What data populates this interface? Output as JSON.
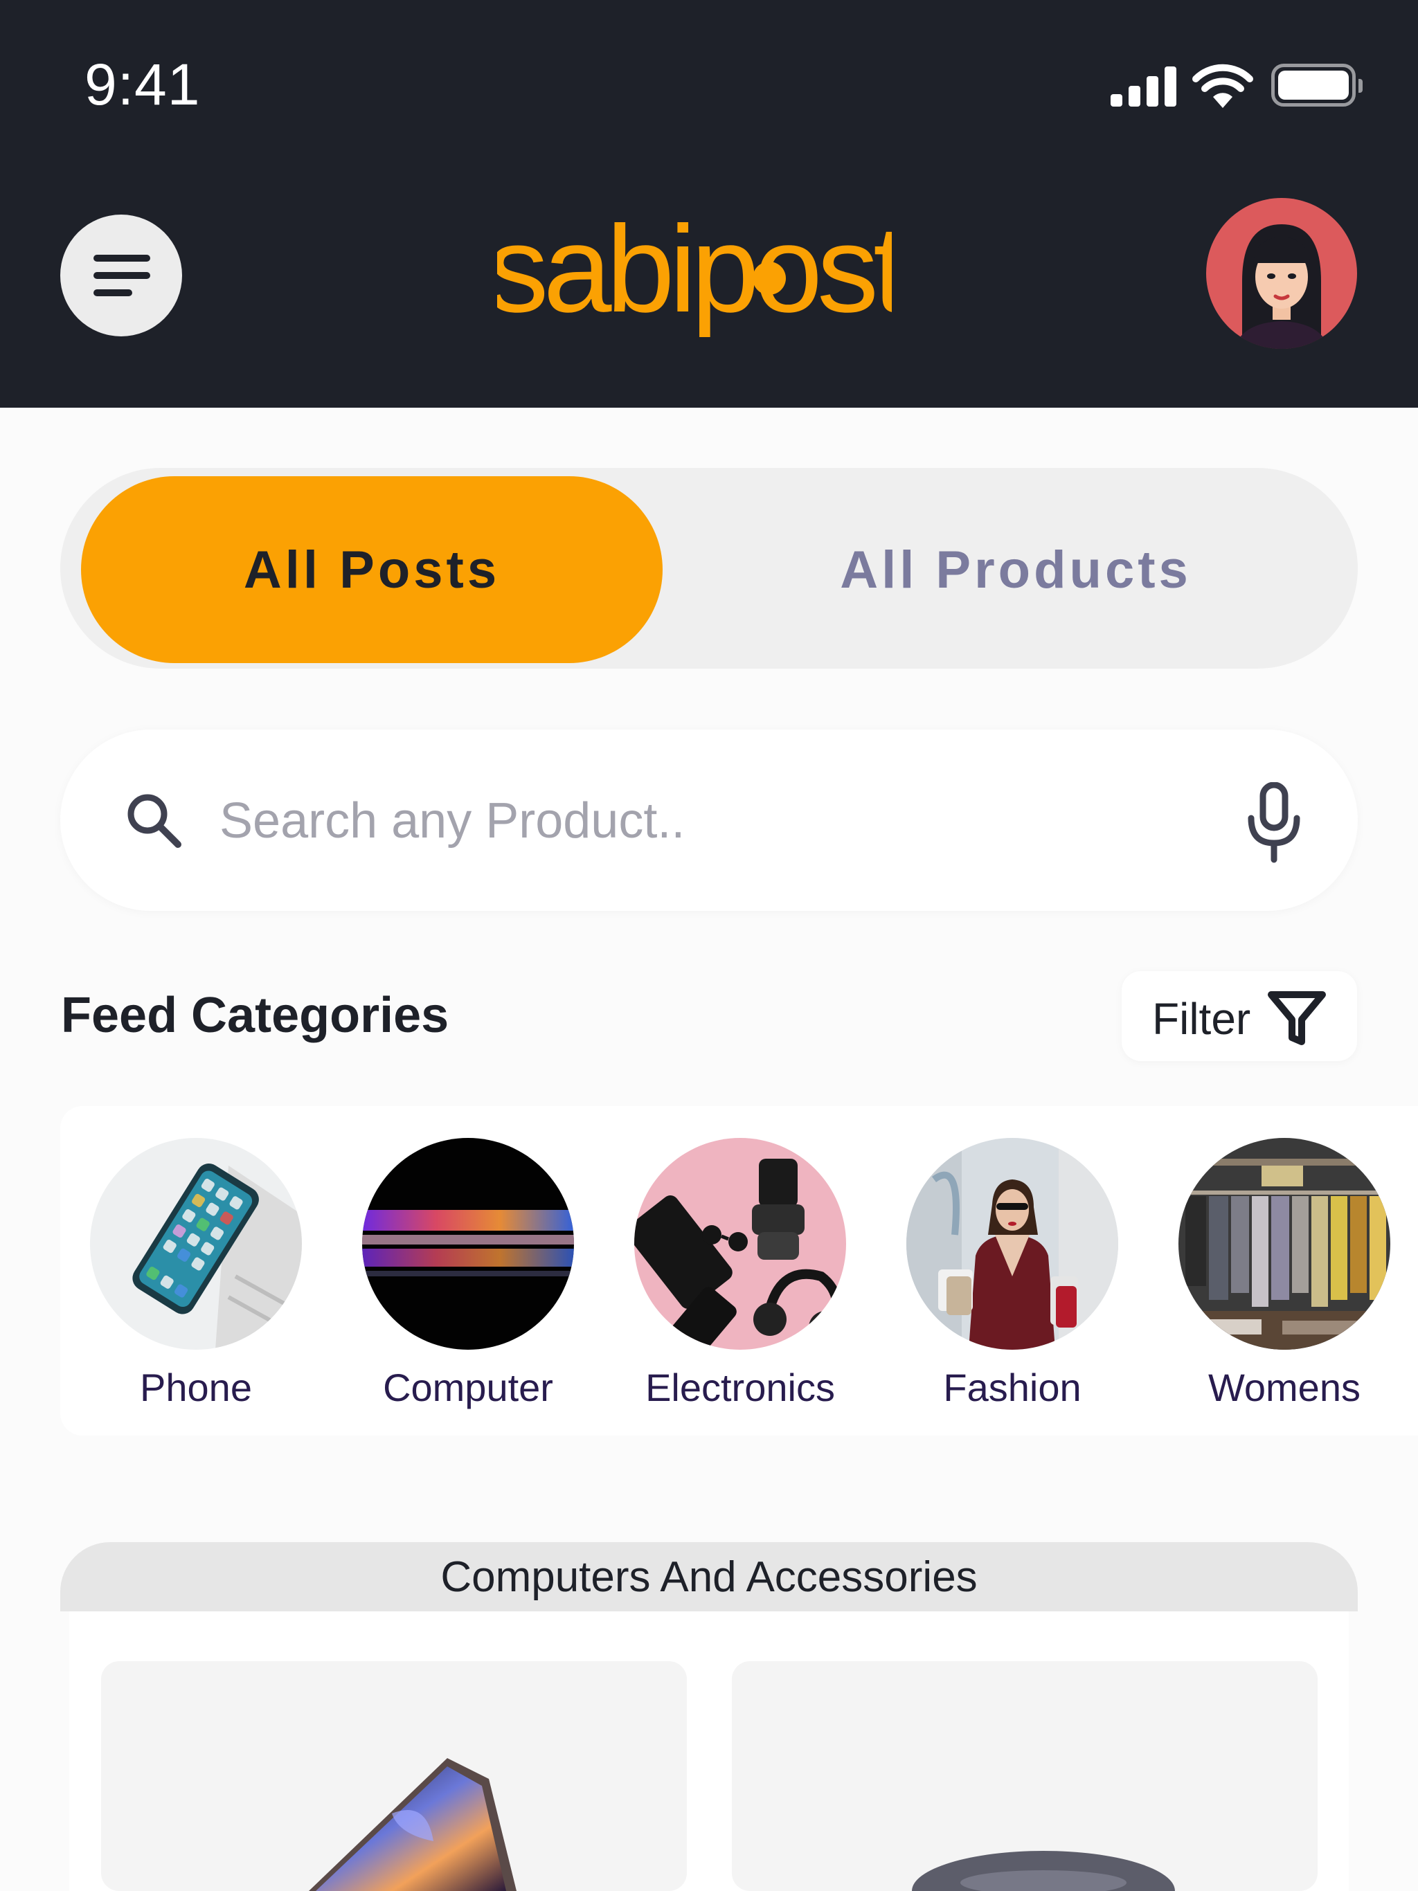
{
  "status_bar": {
    "time": "9:41"
  },
  "header": {
    "logo_text": "sabipost"
  },
  "tabs": [
    {
      "label": "All Posts",
      "active": true
    },
    {
      "label": "All Products",
      "active": false
    }
  ],
  "search": {
    "placeholder": "Search any Product..",
    "value": ""
  },
  "feed": {
    "title": "Feed Categories",
    "filter_label": "Filter",
    "categories": [
      {
        "label": "Phone"
      },
      {
        "label": "Computer"
      },
      {
        "label": "Electronics"
      },
      {
        "label": "Fashion"
      },
      {
        "label": "Womens"
      }
    ]
  },
  "section": {
    "title": "Computers And Accessories"
  },
  "colors": {
    "accent": "#fba103",
    "header_bg": "#1e2129",
    "inactive_tab": "#7b7b9e",
    "category_text": "#281c4e"
  }
}
